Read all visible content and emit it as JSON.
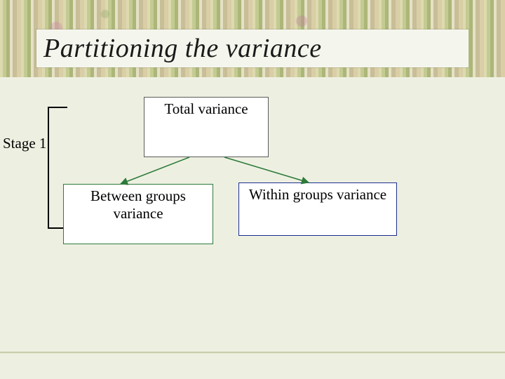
{
  "title": "Partitioning the variance",
  "stage_label": "Stage 1",
  "nodes": {
    "total": "Total variance",
    "between": "Between groups variance",
    "within": "Within groups variance"
  },
  "chart_data": {
    "type": "tree",
    "title": "Partitioning the variance",
    "stages": [
      {
        "label": "Stage 1",
        "parent": "Total variance",
        "children": [
          "Between groups variance",
          "Within groups variance"
        ]
      }
    ]
  }
}
